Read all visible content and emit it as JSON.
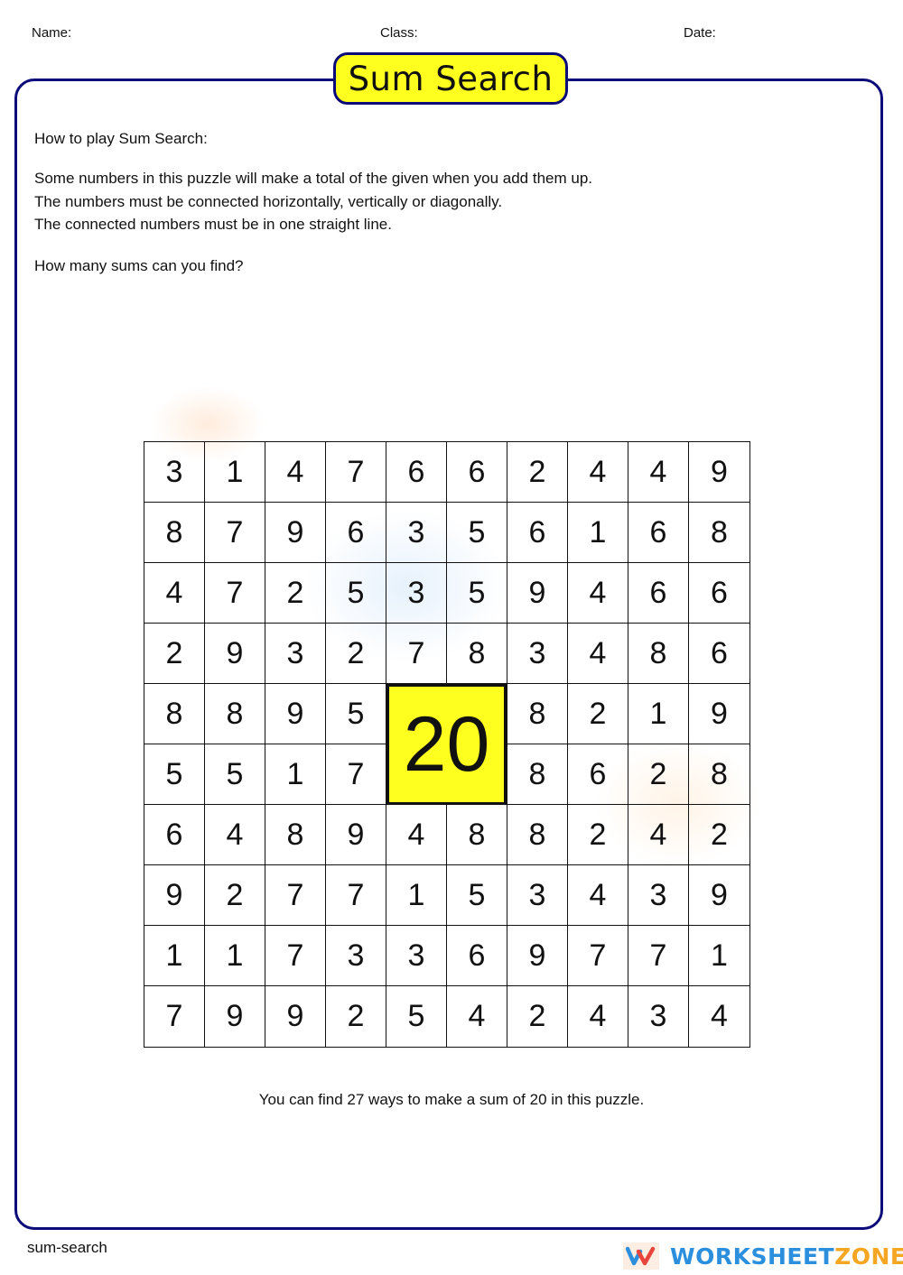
{
  "header": {
    "name_label": "Name:",
    "class_label": "Class:",
    "date_label": "Date:"
  },
  "title": "Sum Search",
  "instructions": {
    "heading": "How to play Sum Search:",
    "lines": [
      "Some numbers in this puzzle will make a total of the given when you add them up.",
      "The numbers must be connected horizontally, vertically or diagonally.",
      "The connected numbers must be in one straight line."
    ],
    "question": "How many sums can you find?"
  },
  "puzzle": {
    "target_sum": "20",
    "target_cells": {
      "rows": [
        5,
        6
      ],
      "cols": [
        5,
        6
      ]
    },
    "grid": [
      [
        "3",
        "1",
        "4",
        "7",
        "6",
        "6",
        "2",
        "4",
        "4",
        "9"
      ],
      [
        "8",
        "7",
        "9",
        "6",
        "3",
        "5",
        "6",
        "1",
        "6",
        "8"
      ],
      [
        "4",
        "7",
        "2",
        "5",
        "3",
        "5",
        "9",
        "4",
        "6",
        "6"
      ],
      [
        "2",
        "9",
        "3",
        "2",
        "7",
        "8",
        "3",
        "4",
        "8",
        "6"
      ],
      [
        "8",
        "8",
        "9",
        "5",
        "",
        "",
        "8",
        "2",
        "1",
        "9"
      ],
      [
        "5",
        "5",
        "1",
        "7",
        "",
        "",
        "8",
        "6",
        "2",
        "8"
      ],
      [
        "6",
        "4",
        "8",
        "9",
        "4",
        "8",
        "8",
        "2",
        "4",
        "2"
      ],
      [
        "9",
        "2",
        "7",
        "7",
        "1",
        "5",
        "3",
        "4",
        "3",
        "9"
      ],
      [
        "1",
        "1",
        "7",
        "3",
        "3",
        "6",
        "9",
        "7",
        "7",
        "1"
      ],
      [
        "7",
        "9",
        "9",
        "2",
        "5",
        "4",
        "2",
        "4",
        "3",
        "4"
      ]
    ]
  },
  "answer_text": "You can find 27 ways to make a sum of 20 in this puzzle.",
  "footer": {
    "slug": "sum-search",
    "logo_letter": "W",
    "logo_text_primary": "WORKSHEET",
    "logo_text_secondary": "ZONE"
  },
  "colors": {
    "frame_border": "#0b0b7a",
    "highlight_yellow": "#ffff1f",
    "logo_blue": "#2b8fde",
    "logo_orange": "#f5a623"
  }
}
